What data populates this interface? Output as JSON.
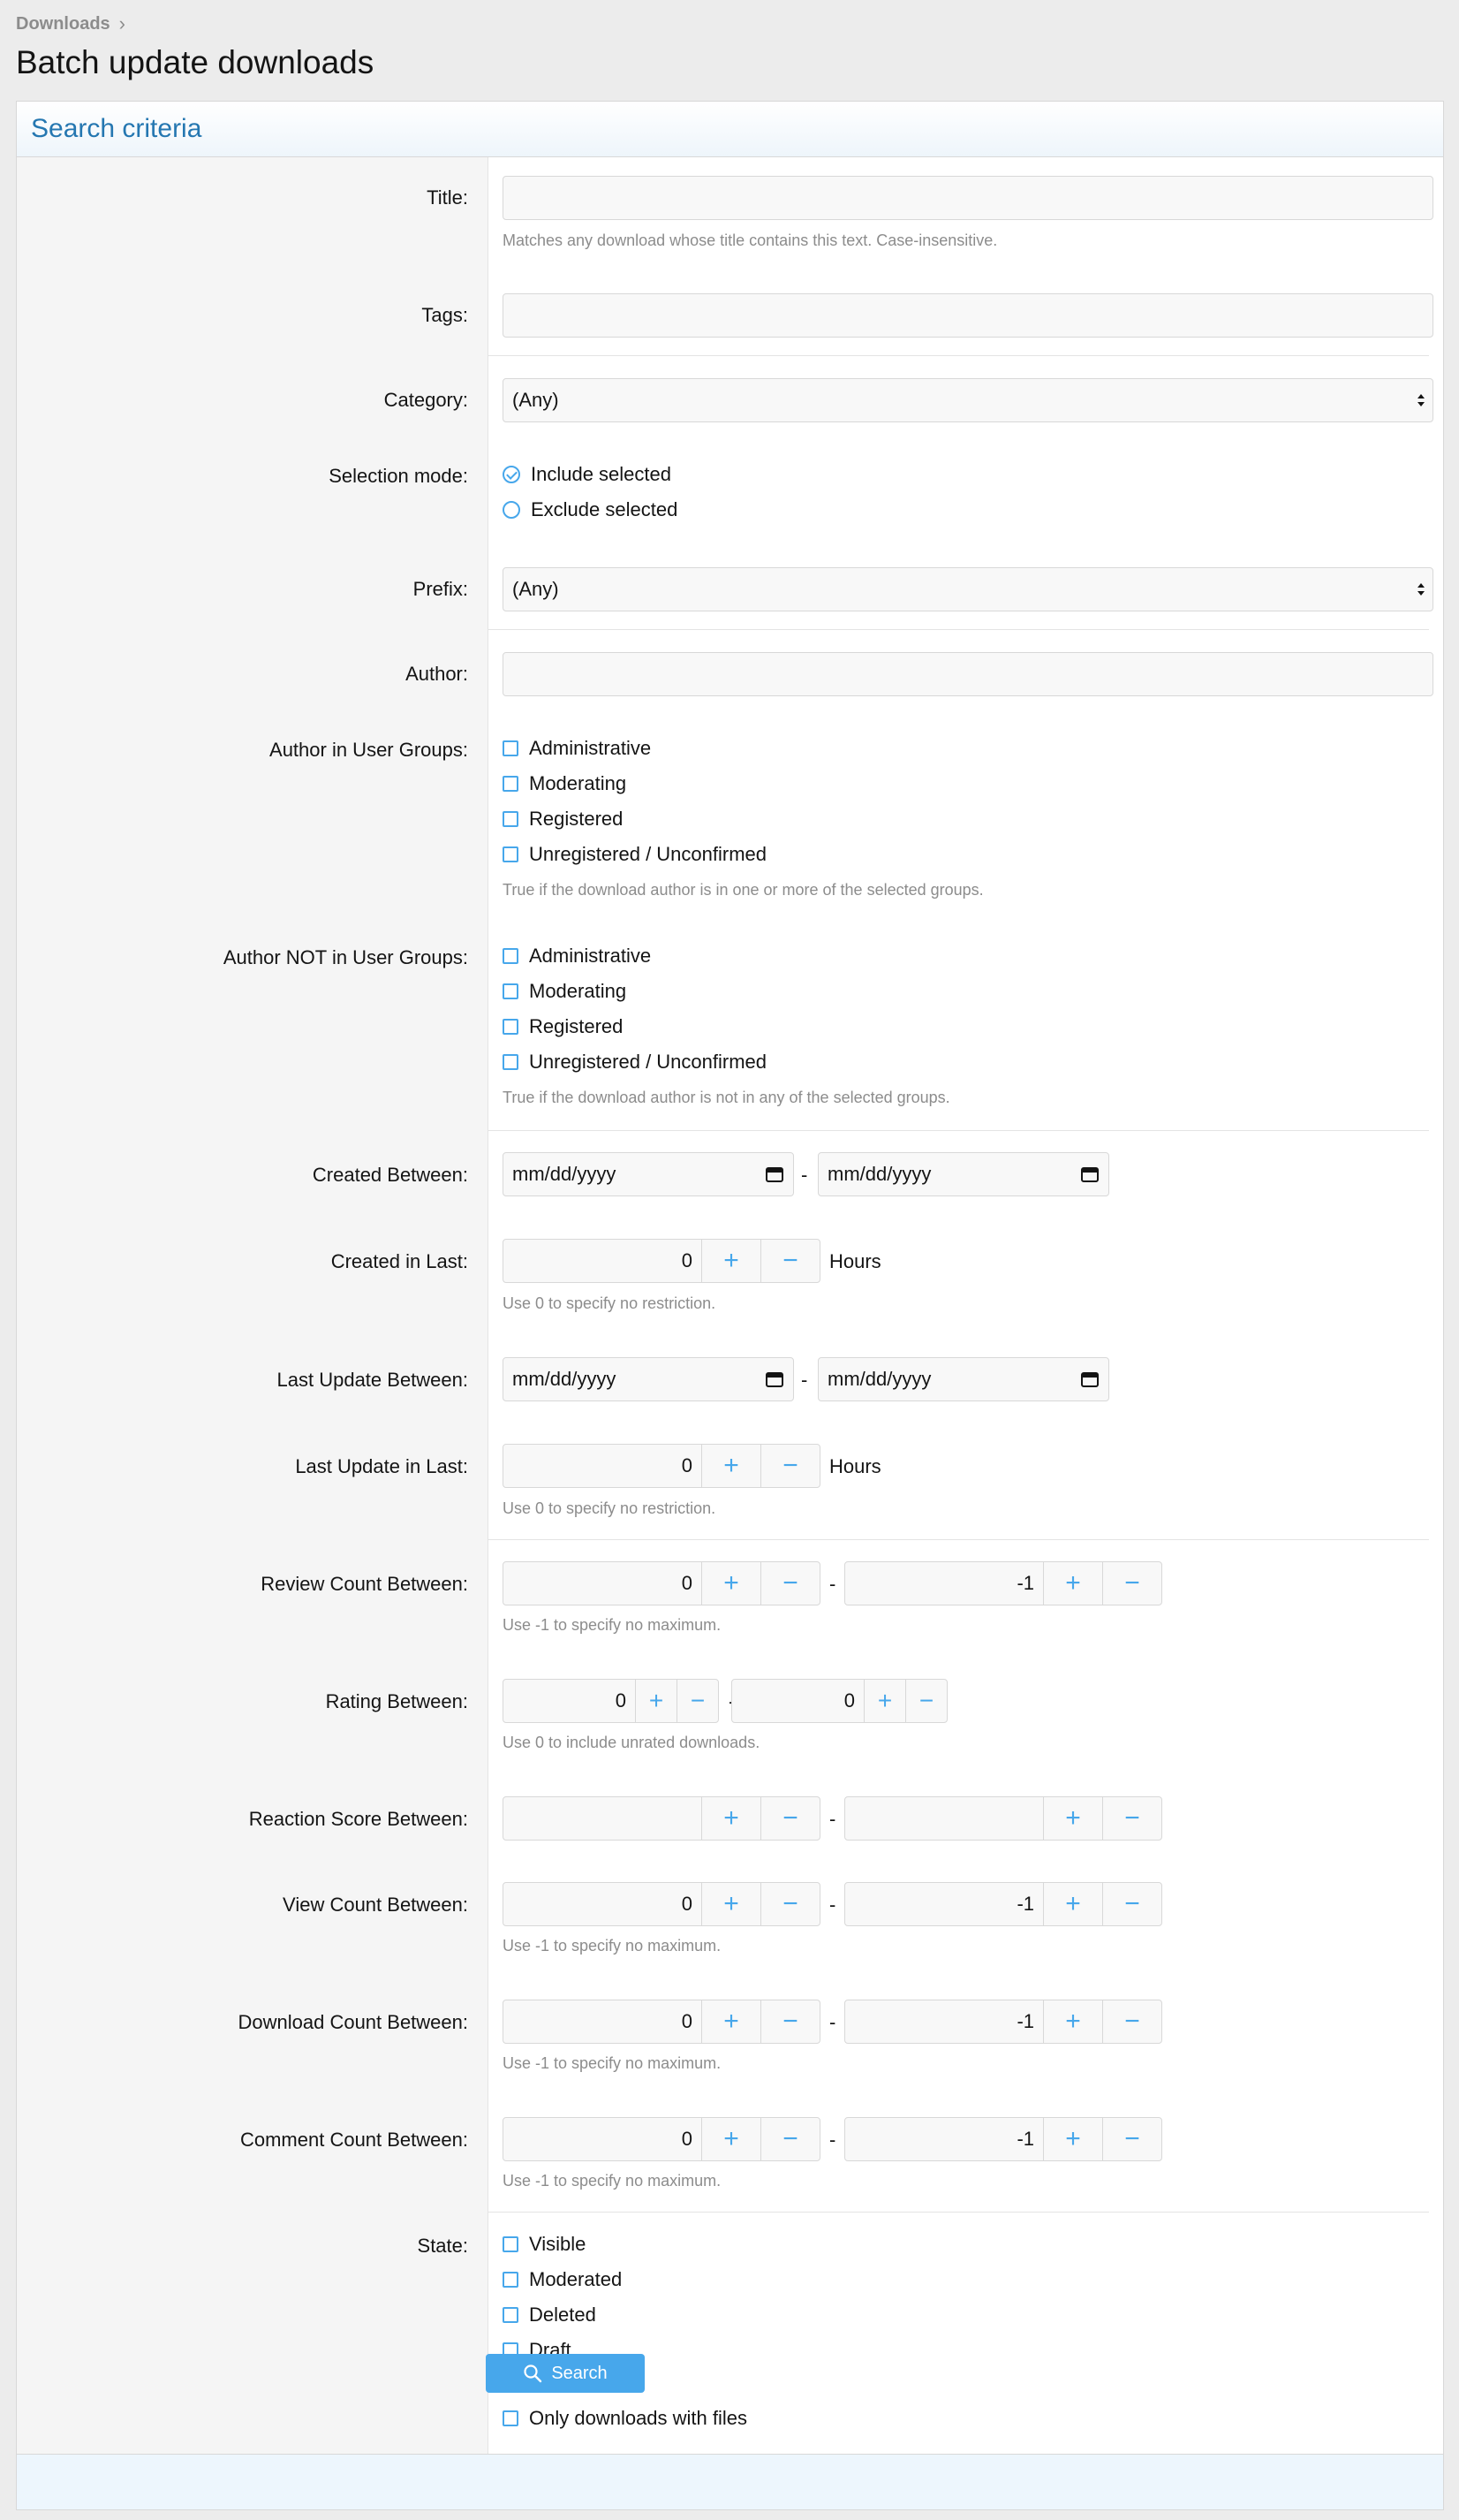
{
  "breadcrumb": {
    "item": "Downloads",
    "separator": "›"
  },
  "page": {
    "title": "Batch update downloads"
  },
  "block": {
    "header": "Search criteria"
  },
  "title": {
    "label": "Title:",
    "value": "",
    "hint": "Matches any download whose title contains this text. Case-insensitive."
  },
  "tags": {
    "label": "Tags:",
    "value": ""
  },
  "category": {
    "label": "Category:",
    "value": "(Any)"
  },
  "selection_mode": {
    "label": "Selection mode:",
    "options": [
      "Include selected",
      "Exclude selected"
    ],
    "selected": "Include selected"
  },
  "prefix": {
    "label": "Prefix:",
    "value": "(Any)"
  },
  "author": {
    "label": "Author:",
    "value": ""
  },
  "author_in_groups": {
    "label": "Author in User Groups:",
    "options": [
      "Administrative",
      "Moderating",
      "Registered",
      "Unregistered / Unconfirmed"
    ],
    "hint": "True if the download author is in one or more of the selected groups."
  },
  "author_not_in_groups": {
    "label": "Author NOT in User Groups:",
    "options": [
      "Administrative",
      "Moderating",
      "Registered",
      "Unregistered / Unconfirmed"
    ],
    "hint": "True if the download author is not in any of the selected groups."
  },
  "created_between": {
    "label": "Created Between:",
    "start_placeholder": "mm/dd/yyyy",
    "end_placeholder": "mm/dd/yyyy",
    "separator": "-"
  },
  "created_in_last": {
    "label": "Created in Last:",
    "value": "0",
    "unit": "Hours",
    "hint": "Use 0 to specify no restriction."
  },
  "last_update_between": {
    "label": "Last Update Between:",
    "start_placeholder": "mm/dd/yyyy",
    "end_placeholder": "mm/dd/yyyy",
    "separator": "-"
  },
  "last_update_in_last": {
    "label": "Last Update in Last:",
    "value": "0",
    "unit": "Hours",
    "hint": "Use 0 to specify no restriction."
  },
  "review_count": {
    "label": "Review Count Between:",
    "min": "0",
    "max": "-1",
    "separator": "-",
    "hint": "Use -1 to specify no maximum."
  },
  "rating": {
    "label": "Rating Between:",
    "min": "0",
    "max": "0",
    "separator": "-",
    "hint": "Use 0 to include unrated downloads."
  },
  "reaction_score": {
    "label": "Reaction Score Between:",
    "min": "",
    "max": "",
    "separator": "-"
  },
  "view_count": {
    "label": "View Count Between:",
    "min": "0",
    "max": "-1",
    "separator": "-",
    "hint": "Use -1 to specify no maximum."
  },
  "download_count": {
    "label": "Download Count Between:",
    "min": "0",
    "max": "-1",
    "separator": "-",
    "hint": "Use -1 to specify no maximum."
  },
  "comment_count": {
    "label": "Comment Count Between:",
    "min": "0",
    "max": "-1",
    "separator": "-",
    "hint": "Use -1 to specify no maximum."
  },
  "state": {
    "label": "State:",
    "options": [
      "Visible",
      "Moderated",
      "Deleted",
      "Draft"
    ]
  },
  "only_files": {
    "label": "Only downloads with files"
  },
  "buttons": {
    "plus": "+",
    "minus": "−",
    "search": "Search"
  },
  "colors": {
    "accent": "#47a7eb",
    "link": "#2577b1",
    "footer": "#edf6fd"
  },
  "icons": {
    "calendar": "calendar-icon",
    "search": "search-icon",
    "select": "select-arrows-icon"
  }
}
